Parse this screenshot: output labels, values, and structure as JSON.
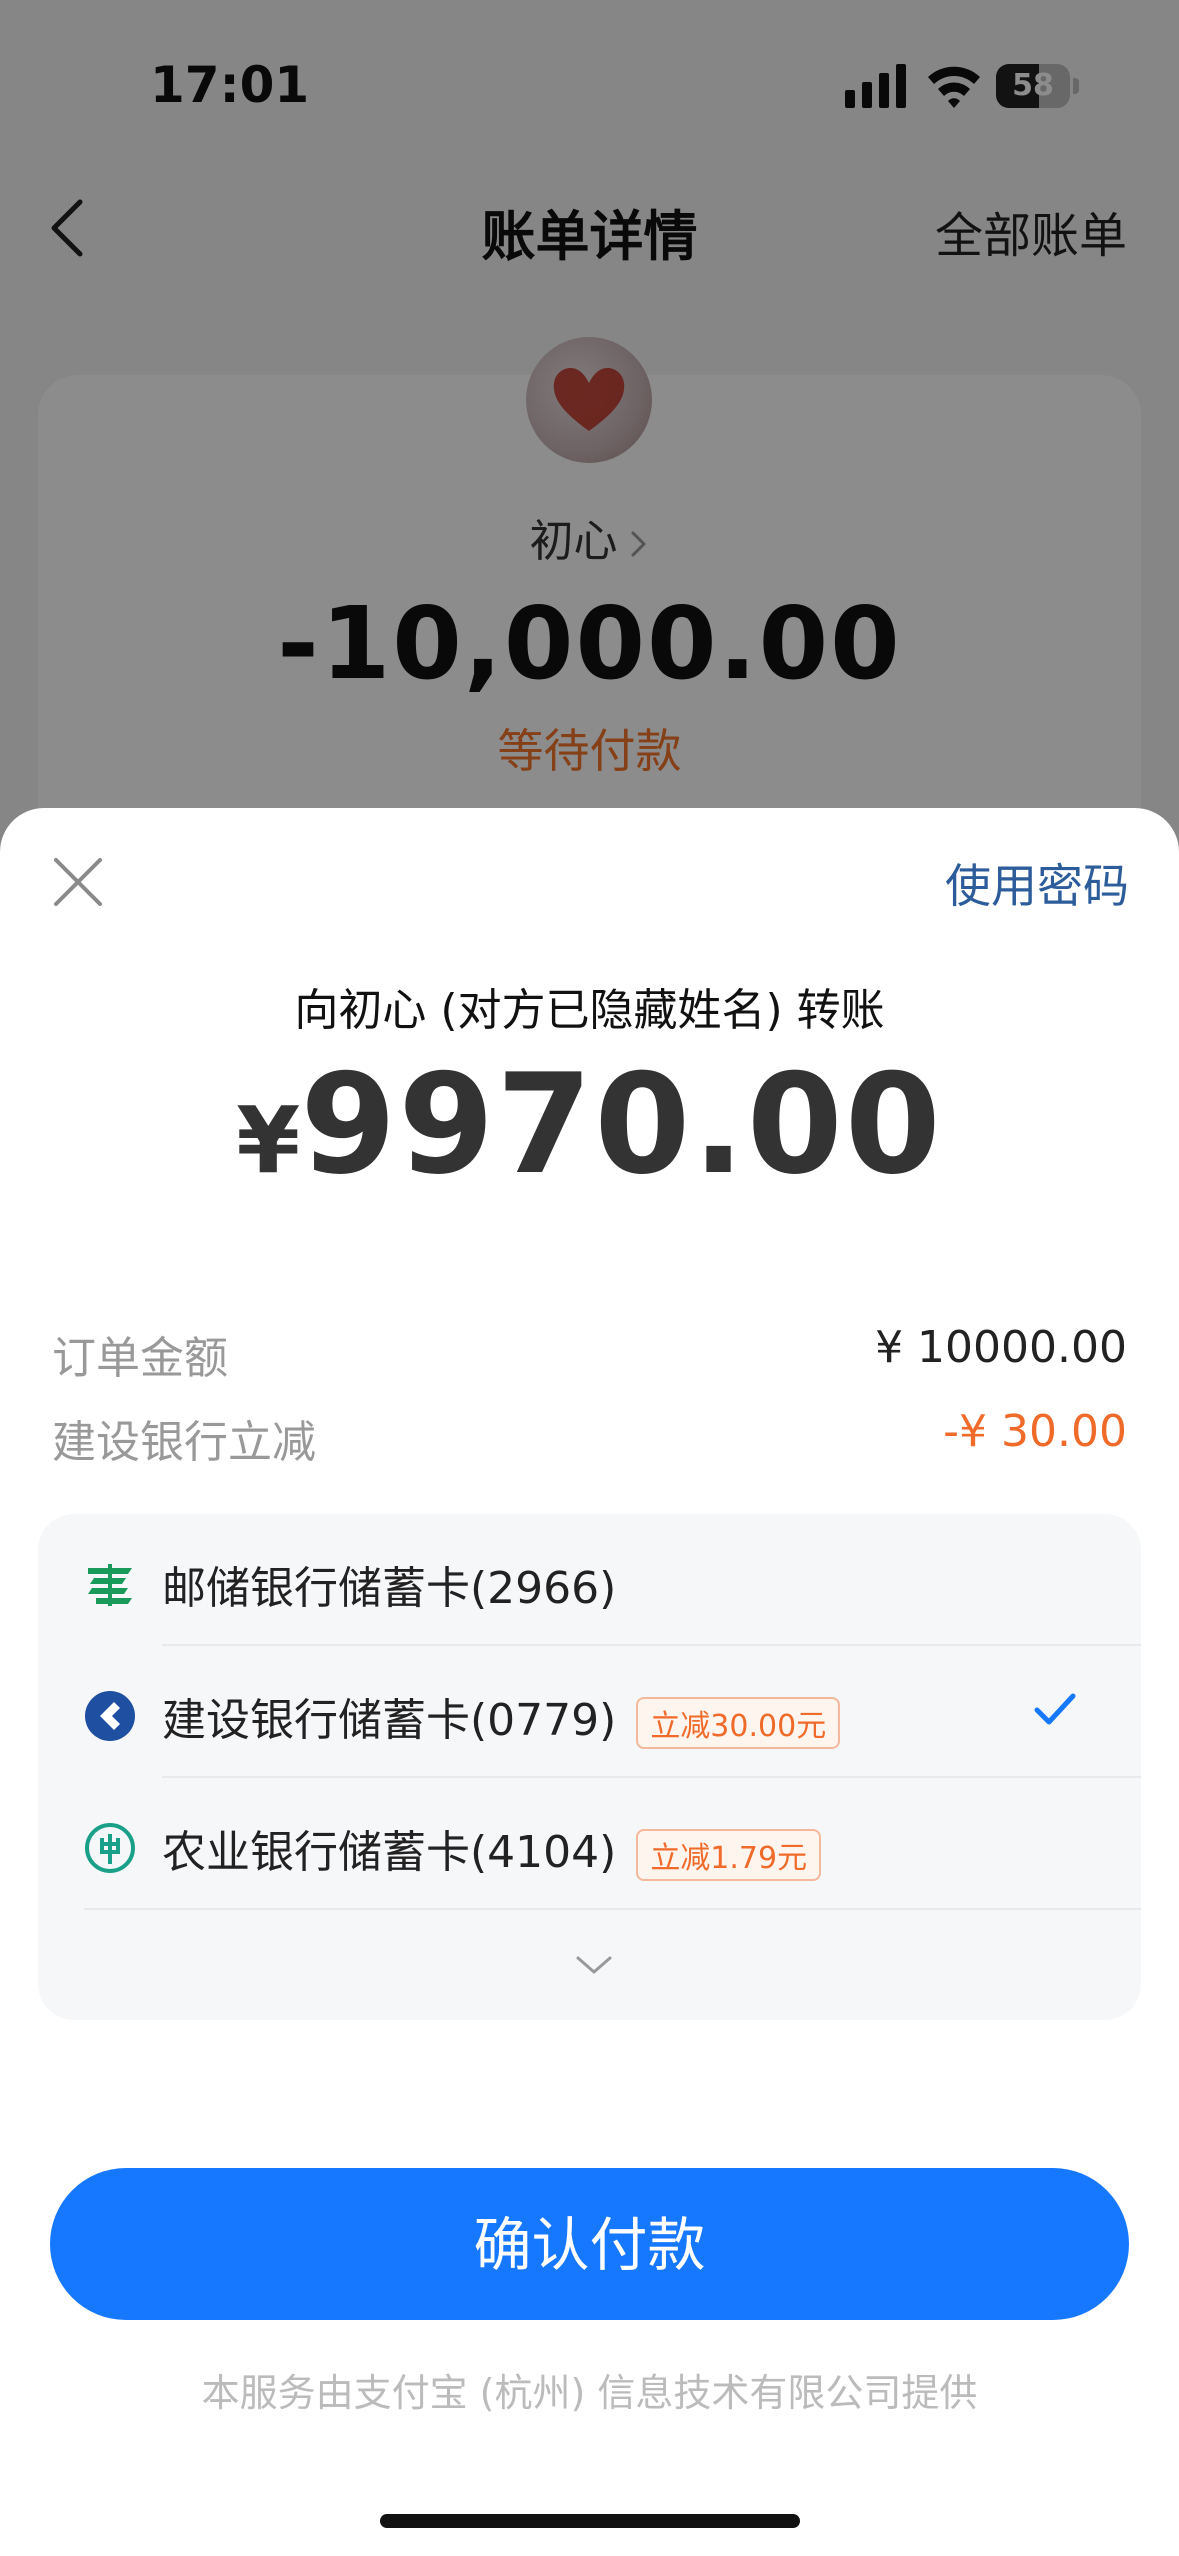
{
  "status_bar": {
    "time": "17:01",
    "battery": "58",
    "battery_level": 0.58
  },
  "nav": {
    "title": "账单详情",
    "right_link": "全部账单"
  },
  "bill": {
    "payee": "初心",
    "amount": "-10,000.00",
    "status": "等待付款"
  },
  "sheet": {
    "use_password": "使用密码",
    "pay_to": "向初心 (对方已隐藏姓名) 转账",
    "currency": "¥",
    "amount": "9970.00",
    "summary": {
      "order_label": "订单金额",
      "order_value": "¥ 10000.00",
      "discount_label": "建设银行立减",
      "discount_value": "-¥ 30.00"
    },
    "cards": [
      {
        "label": "邮储银行储蓄卡(2966)",
        "badge": "",
        "selected": false,
        "logo": "psbc-logo-icon",
        "color": "#1a9a5a"
      },
      {
        "label": "建设银行储蓄卡(0779)",
        "badge": "立减30.00元",
        "selected": true,
        "logo": "ccb-logo-icon",
        "color": "#1f4fa0"
      },
      {
        "label": "农业银行储蓄卡(4104)",
        "badge": "立减1.79元",
        "selected": false,
        "logo": "abc-logo-icon",
        "color": "#1aa089"
      }
    ],
    "confirm_button": "确认付款",
    "provider_note": "本服务由支付宝 (杭州) 信息技术有限公司提供"
  },
  "colors": {
    "primary": "#1677ff",
    "discount": "#f06a2a",
    "status_orange": "#f3762c",
    "link_blue": "#2d5c9a"
  }
}
